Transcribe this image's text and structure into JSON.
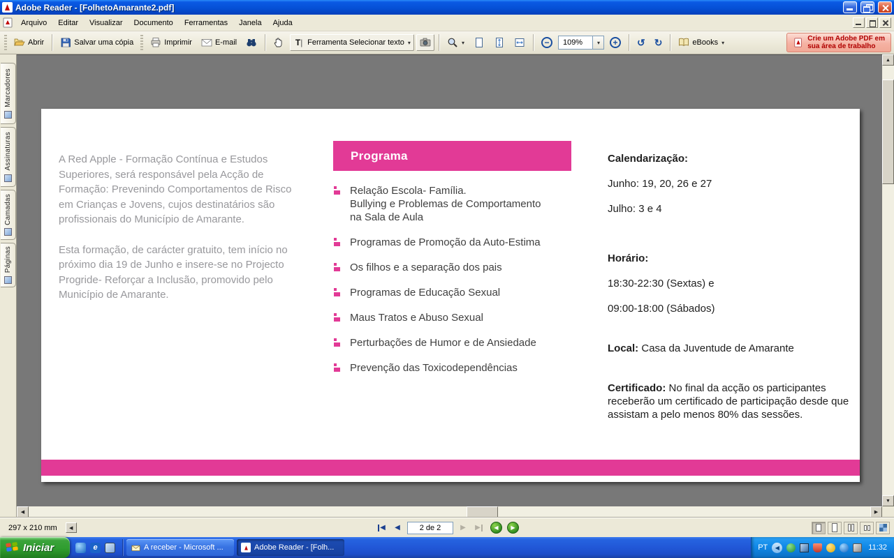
{
  "window": {
    "title": "Adobe Reader - [FolhetoAmarante2.pdf]"
  },
  "menubar": {
    "items": [
      "Arquivo",
      "Editar",
      "Visualizar",
      "Documento",
      "Ferramentas",
      "Janela",
      "Ajuda"
    ]
  },
  "toolbar": {
    "abrir": "Abrir",
    "salvar": "Salvar uma cópia",
    "imprimir": "Imprimir",
    "email": "E-mail",
    "select_tool": "Ferramenta Selecionar texto",
    "zoom_level": "109%",
    "ebooks": "eBooks",
    "create_pdf": "Crie um Adobe PDF em\nsua área de trabalho"
  },
  "sidebar": {
    "tabs": [
      "Marcadores",
      "Assinaturas",
      "Camadas",
      "Páginas"
    ]
  },
  "document": {
    "left_col": {
      "para1": "A Red Apple - Formação Contínua e Estudos Superiores, será responsável pela Acção de Formação: Prevenindo Comportamentos de Risco em Crianças e Jovens, cujos destinatários são profissionais do Município de Amarante.",
      "para2": "Esta formação, de carácter gratuito, tem início no próximo dia 19 de Junho e insere-se no Projecto Progride- Reforçar a Inclusão, promovido pelo Município de Amarante."
    },
    "program": {
      "title": "Programa",
      "items": [
        "Relação Escola- Família.\nBullying e Problemas de Comportamento\nna Sala de Aula",
        "Programas de Promoção da Auto-Estima",
        "Os filhos e a separação dos pais",
        "Programas de Educação Sexual",
        "Maus Tratos e Abuso Sexual",
        "Perturbações de Humor e de Ansiedade",
        "Prevenção das Toxicodependências"
      ]
    },
    "right_col": {
      "cal_title": "Calendarização:",
      "cal_june": "Junho: 19, 20, 26 e 27",
      "cal_july": "Julho: 3 e 4",
      "horario_title": "Horário:",
      "horario_fridays": "18:30-22:30 (Sextas) e",
      "horario_saturdays": "09:00-18:00 (Sábados)",
      "local_label": "Local:",
      "local_value": " Casa da Juventude de Amarante",
      "cert_label": "Certificado:",
      "cert_value": " No final da acção os participantes receberão um certificado de participação desde que assistam a pelo menos 80% das sessões."
    }
  },
  "statusbar": {
    "page_size": "297 x 210 mm",
    "page_nav": "2 de 2"
  },
  "taskbar": {
    "start": "Iniciar",
    "items": [
      "A receber - Microsoft ...",
      "Adobe Reader - [Folh..."
    ],
    "tray_lang": "PT",
    "tray_time": "11:32"
  },
  "icons": {
    "dropdown": "▾",
    "minus": "−",
    "plus": "+",
    "rotate_left": "↺",
    "rotate_right": "↻",
    "up": "▲",
    "down": "▼",
    "left": "◀",
    "right": "▶",
    "chevron_left": "◀",
    "ie_letter": "e"
  },
  "colors": {
    "accent_pink": "#E23A96"
  }
}
